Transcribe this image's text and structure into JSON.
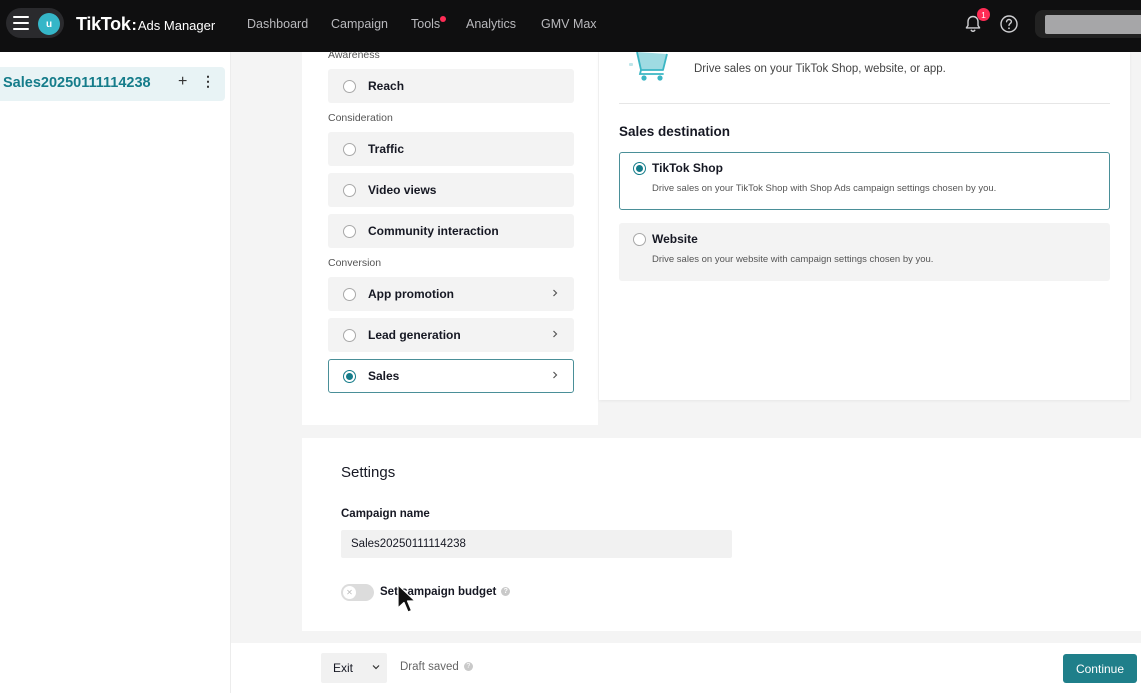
{
  "header": {
    "avatar_letter": "u",
    "logo_main": "TikTok",
    "logo_separator": ":",
    "logo_sub": "Ads Manager",
    "nav": [
      {
        "label": "Dashboard"
      },
      {
        "label": "Campaign"
      },
      {
        "label": "Tools"
      },
      {
        "label": "Analytics"
      },
      {
        "label": "GMV Max"
      }
    ],
    "notification_count": "1"
  },
  "sidebar": {
    "campaign_name": "Sales20250111114238",
    "add_label": "+",
    "more_label": "⋮"
  },
  "objective": {
    "groups": {
      "awareness": "Awareness",
      "consideration": "Consideration",
      "conversion": "Conversion"
    },
    "options": [
      {
        "label": "Reach",
        "selected": false
      },
      {
        "label": "Traffic",
        "selected": false
      },
      {
        "label": "Video views",
        "selected": false
      },
      {
        "label": "Community interaction",
        "selected": false
      },
      {
        "label": "App promotion",
        "selected": false
      },
      {
        "label": "Lead generation",
        "selected": false
      },
      {
        "label": "Sales",
        "selected": true
      }
    ]
  },
  "detail": {
    "description": "Drive sales on your TikTok Shop, website, or app.",
    "destination_title": "Sales destination",
    "destinations": [
      {
        "name": "TikTok Shop",
        "description": "Drive sales on your TikTok Shop with Shop Ads campaign settings chosen by you.",
        "selected": true
      },
      {
        "name": "Website",
        "description": "Drive sales on your website with campaign settings chosen by you.",
        "selected": false
      }
    ]
  },
  "settings": {
    "title": "Settings",
    "campaign_name_label": "Campaign name",
    "campaign_name_value": "Sales20250111114238",
    "budget_label": "Set campaign budget",
    "budget_enabled": false
  },
  "footer": {
    "exit_label": "Exit",
    "draft_status": "Draft saved",
    "continue_label": "Continue"
  },
  "colors": {
    "accent": "#157c8a",
    "button": "#1f7f8a",
    "badge": "#fe2c55",
    "topbar": "#0f0f10"
  }
}
